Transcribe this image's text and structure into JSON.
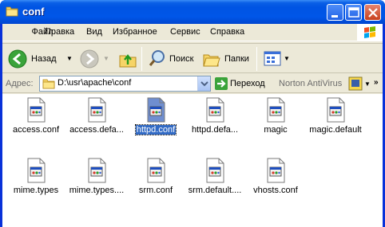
{
  "window": {
    "title": "conf"
  },
  "menu": [
    "Файл",
    "Правка",
    "Вид",
    "Избранное",
    "Сервис",
    "Справка"
  ],
  "toolbar": {
    "back_label": "Назад",
    "search_label": "Поиск",
    "folders_label": "Папки"
  },
  "address": {
    "label": "Адрес:",
    "path": "D:\\usr\\apache\\conf",
    "go_label": "Переход",
    "norton_label": "Norton AntiVirus"
  },
  "files": [
    {
      "name": "access.conf",
      "selected": false
    },
    {
      "name": "access.defa...",
      "selected": false
    },
    {
      "name": "httpd.conf",
      "selected": true
    },
    {
      "name": "httpd.defa...",
      "selected": false
    },
    {
      "name": "magic",
      "selected": false
    },
    {
      "name": "magic.default",
      "selected": false
    },
    {
      "name": "mime.types",
      "selected": false
    },
    {
      "name": "mime.types....",
      "selected": false
    },
    {
      "name": "srm.conf",
      "selected": false
    },
    {
      "name": "srm.default....",
      "selected": false
    },
    {
      "name": "vhosts.conf",
      "selected": false
    }
  ],
  "colors": {
    "titlebar": "#0054e3",
    "selection": "#316ac5",
    "chrome": "#ece9d8"
  }
}
